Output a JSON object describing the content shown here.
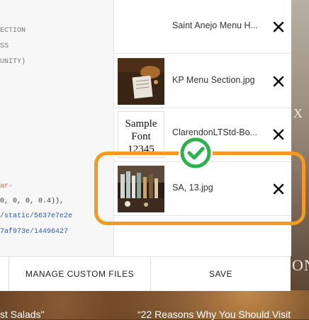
{
  "code_lines": [
    {
      "text": "ECTION",
      "tone": "gray"
    },
    {
      "text": "SS",
      "tone": "gray"
    },
    {
      "text": "UNITY)",
      "tone": "gray"
    },
    {
      "text": "ar-",
      "tone": "orange"
    },
    {
      "text": "0, 0, 0, 0.4)),",
      "tone": "dark"
    },
    {
      "text": "/static/5637e7e2e",
      "tone": "blue"
    },
    {
      "text": "7af973e/14496427",
      "tone": "blue"
    }
  ],
  "files": [
    {
      "name": "Saint Anejo Menu H...",
      "thumb": "none"
    },
    {
      "name": "KP Menu Section.jpg",
      "thumb": "photo-menu"
    },
    {
      "name": "ClarendonLTStd-Bo...",
      "thumb": "font-sample",
      "thumb_text": [
        "Sample",
        "Font",
        "12345"
      ]
    },
    {
      "name": "SA, 13.jpg",
      "thumb": "photo-bar"
    }
  ],
  "footer": {
    "manage_label": "MANAGE CUSTOM FILES",
    "save_label": "SAVE"
  },
  "background": {
    "caption_left": "st Salads\"",
    "caption_right": "“22 Reasons Why You Should Visit",
    "letter_top": "X",
    "letters_bottom": "ON"
  },
  "colors": {
    "highlight": "#f39a1f",
    "check": "#2bb24c"
  },
  "icons": {
    "remove": "close-icon",
    "confirm": "check-circle-icon"
  }
}
